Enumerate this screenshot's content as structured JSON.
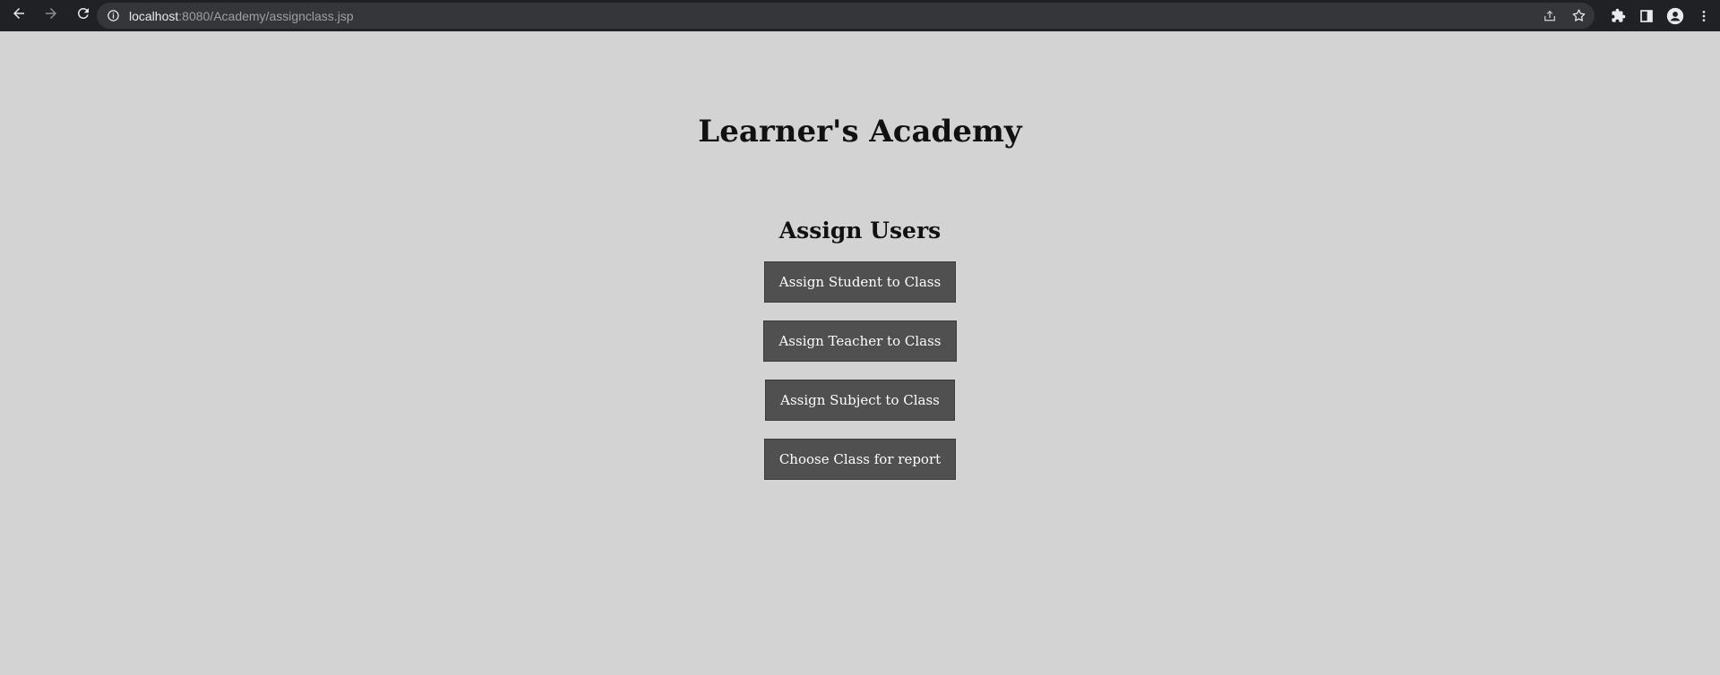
{
  "browser": {
    "url_host": "localhost",
    "url_rest": ":8080/Academy/assignclass.jsp",
    "icons": {
      "back": "back-arrow-icon",
      "forward": "forward-arrow-icon",
      "reload": "reload-icon",
      "info": "info-icon",
      "share": "share-icon",
      "bookmark": "star-icon",
      "extensions": "puzzle-icon",
      "side_panel": "side-panel-icon",
      "profile": "profile-icon",
      "menu": "kebab-menu-icon"
    }
  },
  "page": {
    "title": "Learner's Academy",
    "section_title": "Assign Users",
    "buttons": [
      {
        "label": "Assign Student to Class"
      },
      {
        "label": "Assign Teacher to Class"
      },
      {
        "label": "Assign Subject to Class"
      },
      {
        "label": "Choose Class for report"
      }
    ]
  },
  "colors": {
    "page_background": "#d3d3d3",
    "button_background": "#505050",
    "button_text": "#ffffff",
    "toolbar_background": "#202124"
  }
}
